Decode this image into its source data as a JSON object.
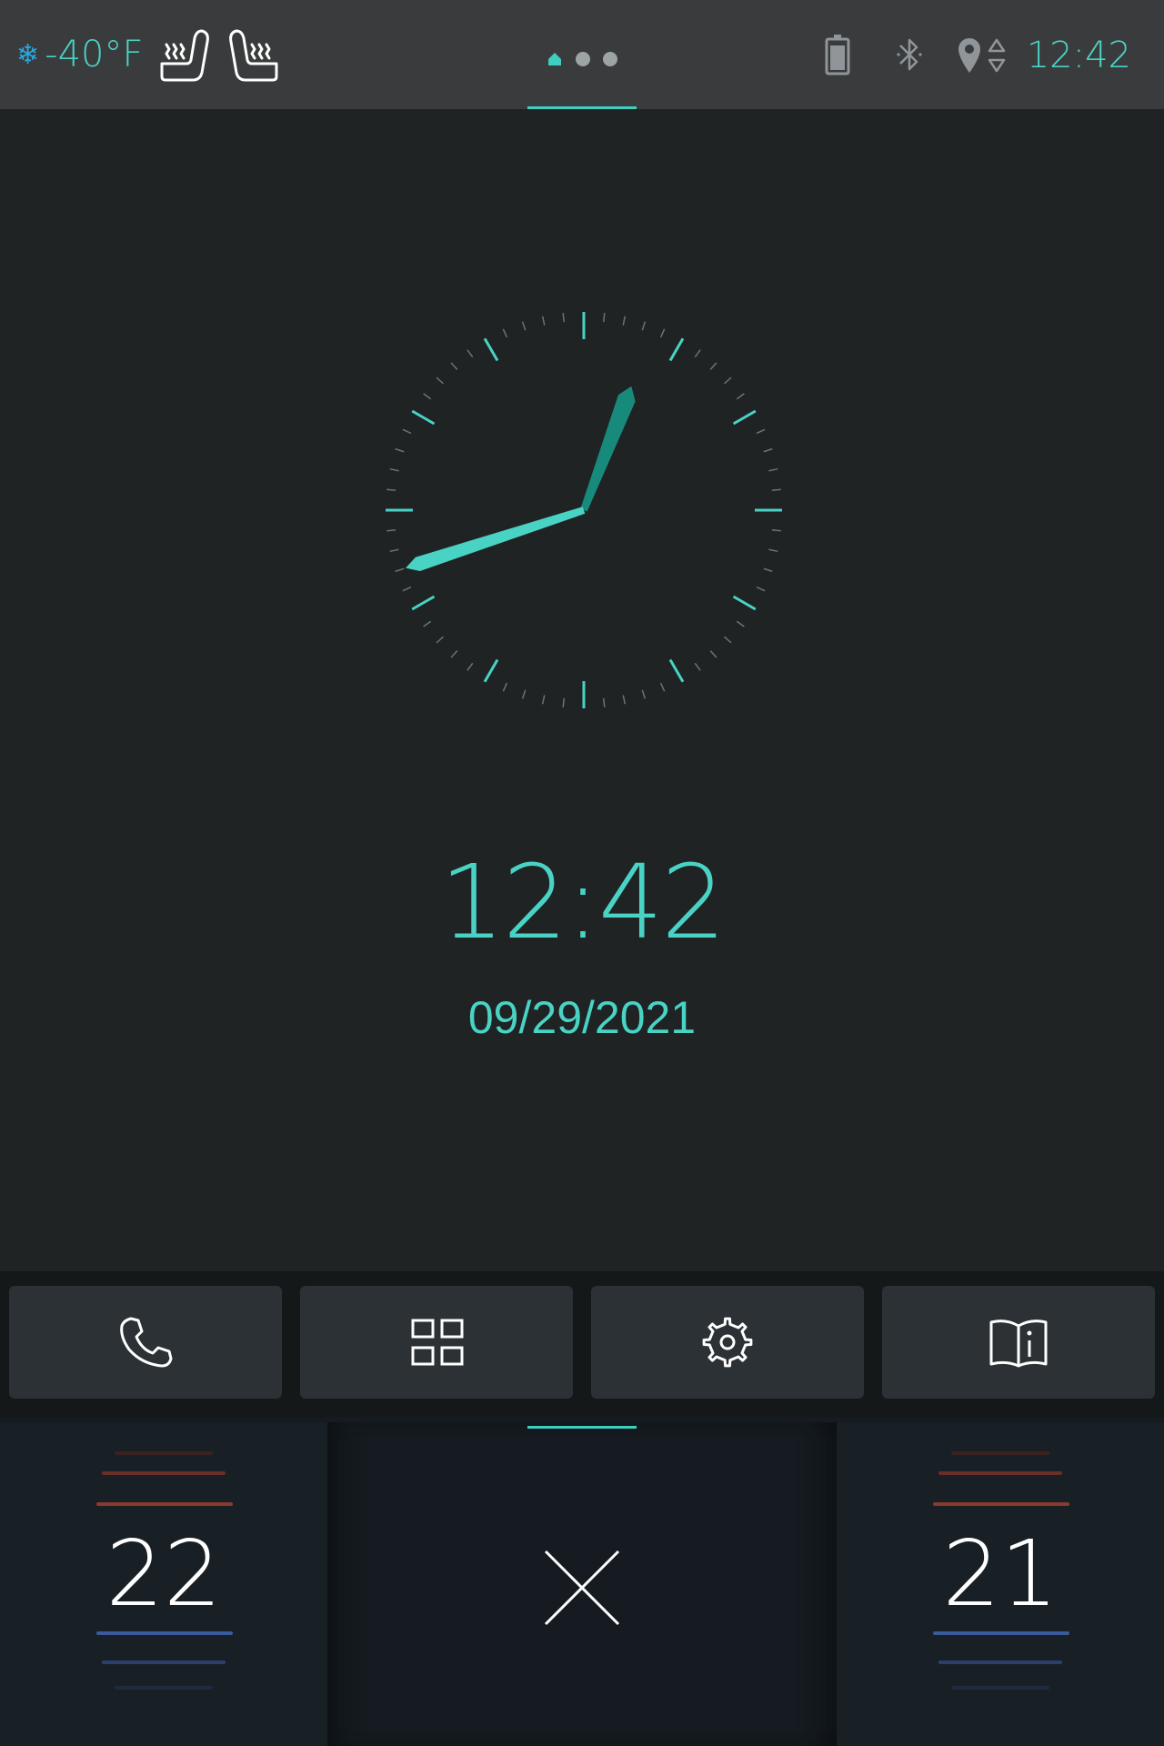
{
  "status_bar": {
    "outside_temp": "-40°F",
    "time": "12:42",
    "page_indicator": {
      "pages": [
        "home",
        "page-2",
        "page-3"
      ],
      "active": 0
    },
    "icons": [
      "snowflake-icon",
      "seat-heat-left-icon",
      "seat-heat-right-icon",
      "battery-icon",
      "bluetooth-icon",
      "location-icon"
    ]
  },
  "clock": {
    "digital_time": "12:42",
    "date": "09/29/2021",
    "hour": 12,
    "minute": 42,
    "accent_color": "#49d3c5",
    "hour_hand_color": "#188a7c"
  },
  "dock": {
    "buttons": [
      "phone-icon",
      "apps-grid-icon",
      "settings-gear-icon",
      "manual-info-icon"
    ]
  },
  "climate": {
    "left_temp": "22",
    "right_temp": "21",
    "center_control": "close-icon",
    "warm_color": "#8a3a2e",
    "cool_color": "#3b5a9e"
  }
}
